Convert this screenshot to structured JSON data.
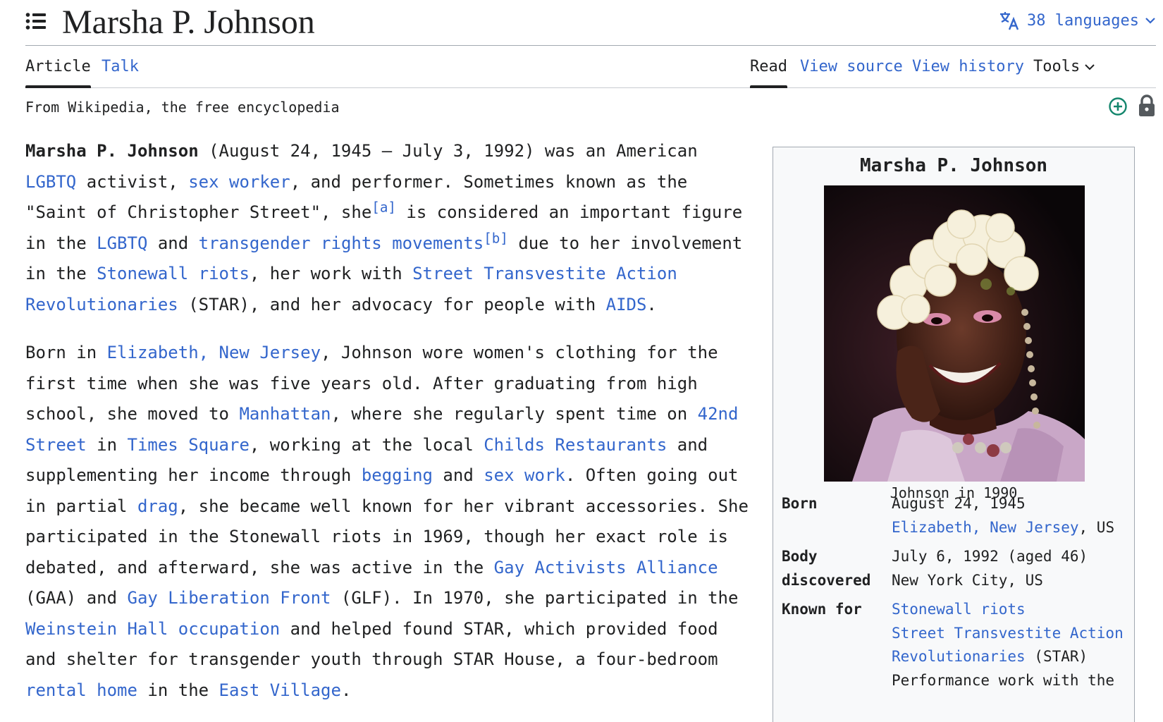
{
  "header": {
    "title": "Marsha P. Johnson",
    "languages_label": "38 languages"
  },
  "tabs": {
    "left": [
      {
        "label": "Article",
        "selected": true
      },
      {
        "label": "Talk",
        "selected": false
      }
    ],
    "right": [
      {
        "label": "Read",
        "selected": true
      },
      {
        "label": "View source",
        "selected": false
      },
      {
        "label": "View history",
        "selected": false
      },
      {
        "label": "Tools",
        "selected": false
      }
    ]
  },
  "tagline": "From Wikipedia, the free encyclopedia",
  "article": {
    "p1": {
      "subject": "Marsha P. Johnson",
      "t1": " (August 24, 1945 – July 3, 1992) was an American ",
      "link_lgbtq": "LGBTQ",
      "t2": " activist, ",
      "link_sex_worker": "sex worker",
      "t3": ", and performer. Sometimes known as the \"Saint of Christopher Street\", she",
      "ref_a": "[a]",
      "t4": " is considered an important figure in the ",
      "link_lgbtq2": "LGBTQ",
      "t5": " and ",
      "link_trans_rights": "transgender rights movements",
      "ref_b": "[b]",
      "t6": " due to her involvement in the ",
      "link_stonewall": "Stonewall riots",
      "t7": ", her work with ",
      "link_star": "Street Transvestite Action Revolutionaries",
      "t8": " (STAR), and her advocacy for people with ",
      "link_aids": "AIDS",
      "t9": "."
    },
    "p2": {
      "t1": "Born in ",
      "link_elizabeth": "Elizabeth, New Jersey",
      "t2": ", Johnson wore women's clothing for the first time when she was five years old. After graduating from high school, she moved to ",
      "link_manhattan": "Manhattan",
      "t3": ", where she regularly spent time on ",
      "link_42nd": "42nd Street",
      "t4": " in ",
      "link_times_square": "Times Square",
      "t5": ", working at the local ",
      "link_childs": "Childs Restaurants",
      "t6": " and supplementing her income through ",
      "link_begging": "begging",
      "t7": " and ",
      "link_sex_work": "sex work",
      "t8": ". Often going out in partial ",
      "link_drag": "drag",
      "t9": ", she became well known for her vibrant accessories. She participated in the Stonewall riots in 1969, though her exact role is debated, and afterward, she was active in the ",
      "link_gaa": "Gay Activists Alliance",
      "t10": " (GAA) and ",
      "link_glf": "Gay Liberation Front",
      "t11": " (GLF). In 1970, she participated in the ",
      "link_weinstein": "Weinstein Hall occupation",
      "t12": " and helped found STAR, which provided food and shelter for transgender youth through STAR House, a four-bedroom ",
      "link_rental": "rental home",
      "t13": " in the ",
      "link_east_village": "East Village",
      "t14": "."
    }
  },
  "infobox": {
    "title": "Marsha P. Johnson",
    "caption": "Johnson in 1990",
    "born_label": "Born",
    "born_date": "August 24, 1945",
    "born_place_link": "Elizabeth, New Jersey",
    "born_place_suffix": ", US",
    "body_label_1": "Body",
    "body_label_2": "discovered",
    "body_date": "July 6, 1992 (aged 46)",
    "body_place": "New York City, US",
    "known_label": "Known for",
    "known_1": "Stonewall riots",
    "known_2a": "Street Transvestite Action",
    "known_2b": "Revolutionaries",
    "known_2_suffix": " (STAR)",
    "known_3": "Performance work with the"
  },
  "colors": {
    "link": "#3366cc",
    "text": "#202122",
    "infobox_bg": "#f8f9fa",
    "border": "#a2a9b1",
    "indicator_green": "#14866d",
    "indicator_gray": "#54595d"
  },
  "icons": {
    "toc": "toc-list-icon",
    "language": "translate-icon",
    "dropdown": "chevron-down-icon",
    "added": "plus-circle-icon",
    "protected": "lock-icon"
  }
}
